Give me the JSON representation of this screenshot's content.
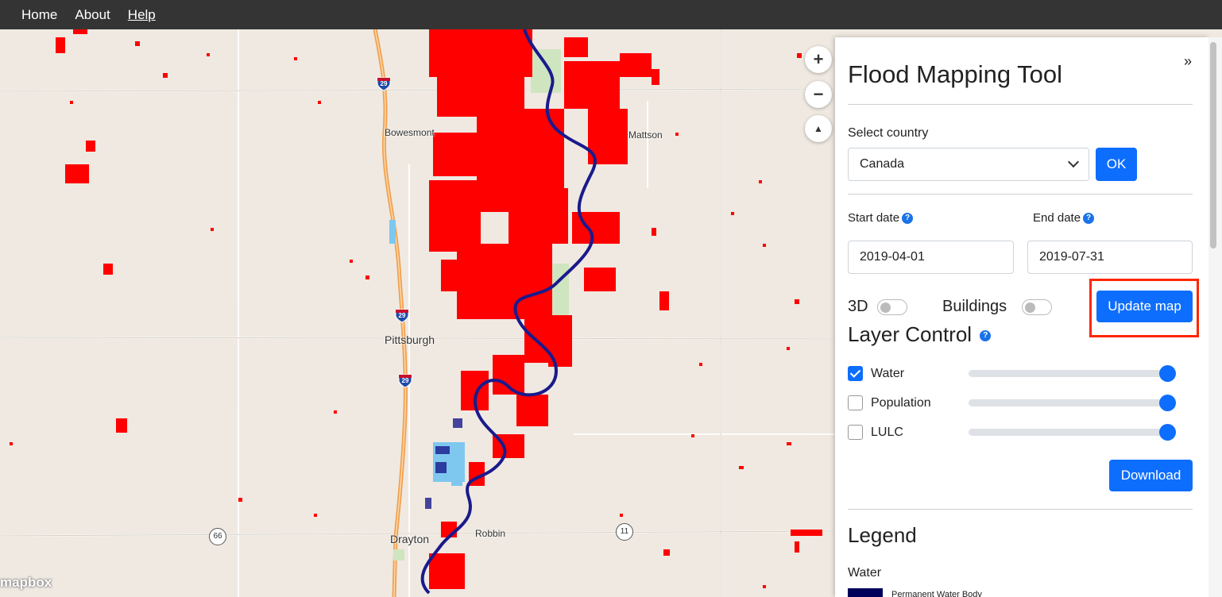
{
  "nav": {
    "home": "Home",
    "about": "About",
    "help": "Help"
  },
  "map": {
    "places": {
      "bowesmont": "Bowesmont",
      "mattson": "Mattson",
      "pittsburgh": "Pittsburgh",
      "drayton": "Drayton",
      "robbin": "Robbin"
    },
    "interstate": "29",
    "routes": {
      "r66": "66",
      "r11": "11"
    },
    "attribution": "mapbox",
    "zoom_in": "+",
    "zoom_out": "−",
    "compass": "▲"
  },
  "panel": {
    "collapse": "»",
    "title": "Flood Mapping Tool",
    "select_country_label": "Select country",
    "country": "Canada",
    "ok": "OK",
    "start_date_label": "Start date",
    "end_date_label": "End date",
    "start_date": "2019-04-01",
    "end_date": "2019-07-31",
    "toggle_3d": "3D",
    "toggle_buildings": "Buildings",
    "update_map": "Update map",
    "layer_control": "Layer Control",
    "layers": [
      {
        "label": "Water",
        "checked": true,
        "opacity": 1.0
      },
      {
        "label": "Population",
        "checked": false,
        "opacity": 1.0
      },
      {
        "label": "LULC",
        "checked": false,
        "opacity": 1.0
      }
    ],
    "download": "Download",
    "legend_title": "Legend",
    "legend_section": "Water",
    "legend_item": "Permanent Water Body"
  },
  "colors": {
    "flood": "#ff0000",
    "river": "#1a1a8c",
    "road": "#f0a050",
    "accent": "#0d6efd",
    "highlight": "#ff2600"
  }
}
